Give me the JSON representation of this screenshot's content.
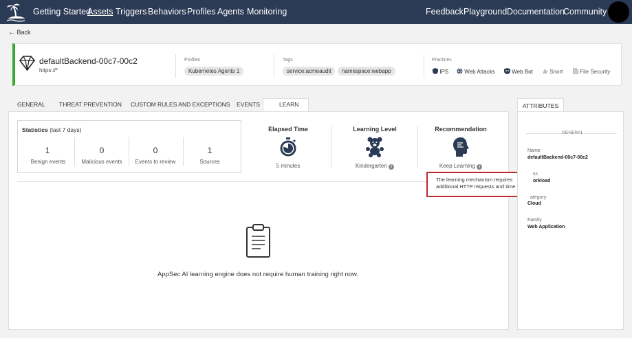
{
  "nav": {
    "left": [
      "Getting Started",
      "Assets",
      "Triggers",
      "Behaviors",
      "Profiles",
      "Agents",
      "Monitoring"
    ],
    "right": [
      "Feedback",
      "Playground",
      "Documentation",
      "Community"
    ],
    "active": "Assets"
  },
  "back_label": "Back",
  "asset": {
    "name": "defaultBackend-00c7-00c2",
    "url": "https://*",
    "profiles_label": "Profiles",
    "profiles": [
      "Kubernetes Agents 1"
    ],
    "tags_label": "Tags",
    "tags": [
      "service:acmeaudit",
      "namespace:webapp"
    ],
    "practices_label": "Practices",
    "practices": [
      "IPS",
      "Web Attacks",
      "Web Bot",
      "Snort",
      "File Security"
    ]
  },
  "tabs": [
    "GENERAL",
    "THREAT PREVENTION",
    "CUSTOM RULES AND EXCEPTIONS",
    "EVENTS",
    "LEARN"
  ],
  "active_tab": "LEARN",
  "stats": {
    "title": "Statistics",
    "subtitle": "(last 7 days)",
    "items": [
      {
        "value": "1",
        "label": "Benign events"
      },
      {
        "value": "0",
        "label": "Malicious events"
      },
      {
        "value": "0",
        "label": "Events to review"
      },
      {
        "value": "1",
        "label": "Sources"
      }
    ]
  },
  "metrics": [
    {
      "title": "Elapsed Time",
      "value": "5 minutes",
      "icon": "timer-icon"
    },
    {
      "title": "Learning Level",
      "value": "Kindergarten",
      "icon": "teddy-bear-icon"
    },
    {
      "title": "Recommendation",
      "value": "Keep Learning",
      "icon": "brain-head-icon"
    }
  ],
  "tooltip": "The learning mechanism requires additional HTTP requests and time",
  "empty_message": "AppSec AI learning engine does not require human training right now.",
  "attributes": {
    "tab_label": "ATTRIBUTES",
    "section": "GENERAL",
    "fields": [
      {
        "label": "Name",
        "value": "defaultBackend-00c7-00c2"
      },
      {
        "label": "ss",
        "value": "orkload"
      },
      {
        "label": "ategory",
        "value": "Cloud"
      },
      {
        "label": "Family",
        "value": "Web Application"
      }
    ]
  }
}
